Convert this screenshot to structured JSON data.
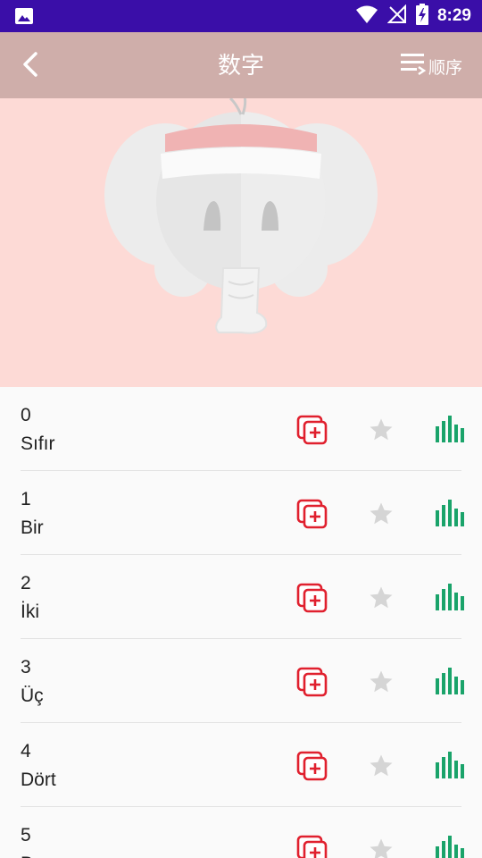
{
  "status_bar": {
    "time": "8:29",
    "icons": [
      "image-icon",
      "wifi-icon",
      "no-signal-icon",
      "battery-charging-icon"
    ]
  },
  "app_bar": {
    "title": "数字",
    "order_label": "顺序",
    "icons": [
      "back-arrow-icon",
      "sort-list-icon"
    ]
  },
  "hero": {
    "image": "elephant-mascot",
    "background_color": "#fddad6"
  },
  "colors": {
    "status_bar": "#3a0ea8",
    "app_bar": "#cfaeaa",
    "add_icon": "#e0202e",
    "star_icon": "#d5d5d5",
    "stats_icon": "#1aa36a"
  },
  "words": [
    {
      "number": "0",
      "text": "Sıfır"
    },
    {
      "number": "1",
      "text": "Bir"
    },
    {
      "number": "2",
      "text": "İki"
    },
    {
      "number": "3",
      "text": "Üç"
    },
    {
      "number": "4",
      "text": "Dört"
    },
    {
      "number": "5",
      "text": "Beş"
    }
  ],
  "row_actions": [
    "add-card-icon",
    "star-icon",
    "stats-icon"
  ]
}
